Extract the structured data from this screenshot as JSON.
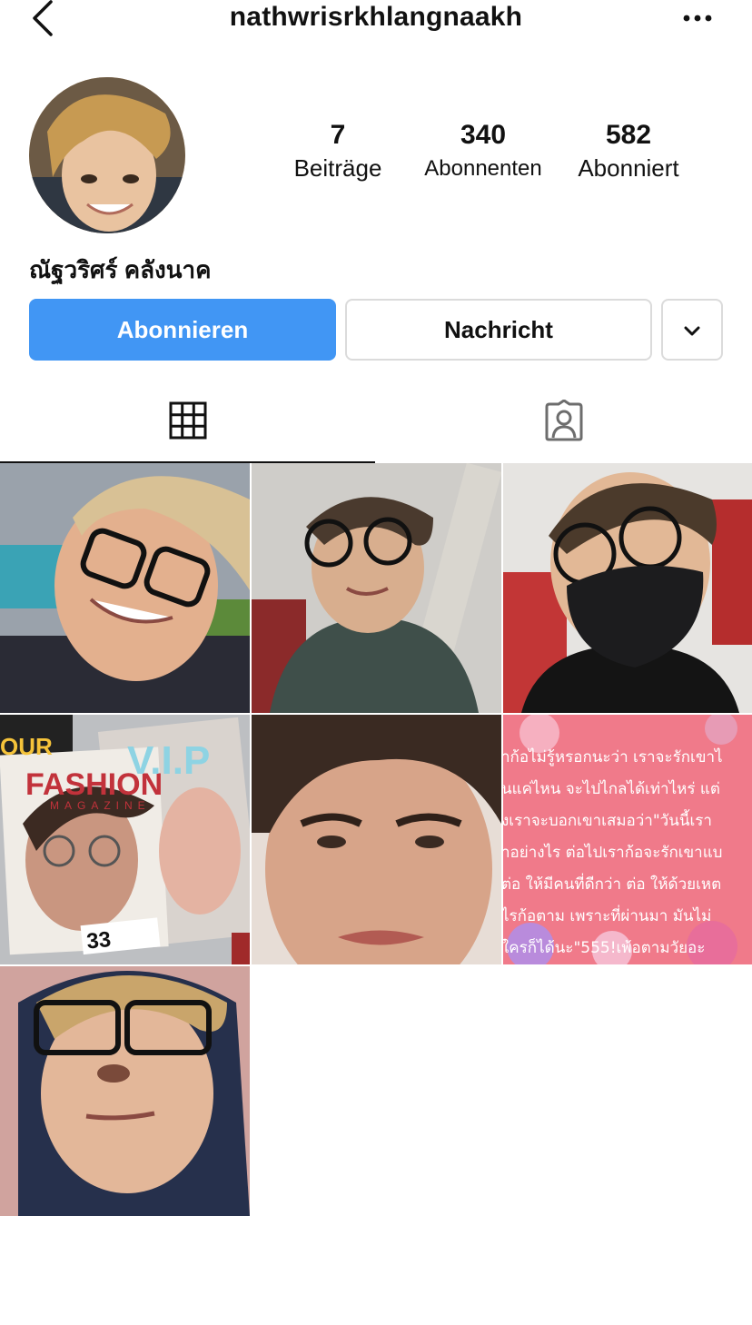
{
  "header": {
    "username": "nathwrisrkhlangnaakh",
    "back_icon": "chevron-left-icon",
    "more_icon": "ellipsis-horizontal-icon"
  },
  "profile": {
    "display_name": "ณัฐวริศร์ คลังนาค",
    "stats": {
      "posts": {
        "count": "7",
        "label": "Beiträge"
      },
      "followers": {
        "count": "340",
        "label": "Abonnenten"
      },
      "following": {
        "count": "582",
        "label": "Abonniert"
      }
    }
  },
  "actions": {
    "follow_label": "Abonnieren",
    "message_label": "Nachricht",
    "dropdown_icon": "chevron-down-icon"
  },
  "tabs": {
    "grid_icon": "grid-icon",
    "tagged_icon": "tagged-person-icon"
  },
  "posts": {
    "cover_magazine_title": "FASHION",
    "cover_magazine_sub": "MAGAZINE",
    "cover_vip": "V.I.P",
    "cover_our": "OUR",
    "cover_issue": "33",
    "text_post_lines": [
      "าก้อไม่รู้หรอกนะว่า เราจะรักเขาไ",
      "นแค่ไหน จะไปไกลได้เท่าไหร่ แต่",
      "งเราจะบอกเขาเสมอว่า\"วันนี้เรา",
      "าอย่างไร ต่อไปเราก้อจะรักเขาแบ",
      "ต่อ ให้มีคนที่ดีกว่า ต่อ ให้ด้วยเหต",
      "ไรก้อตาม เพราะที่ผ่านมา มันไม่",
      "ใครก็ได้นะ\"555!เพ้อตามวัยอะ"
    ]
  },
  "colors": {
    "primary_blue": "#4196f4",
    "border_gray": "#dbdbdb",
    "text_dark": "#111111"
  }
}
